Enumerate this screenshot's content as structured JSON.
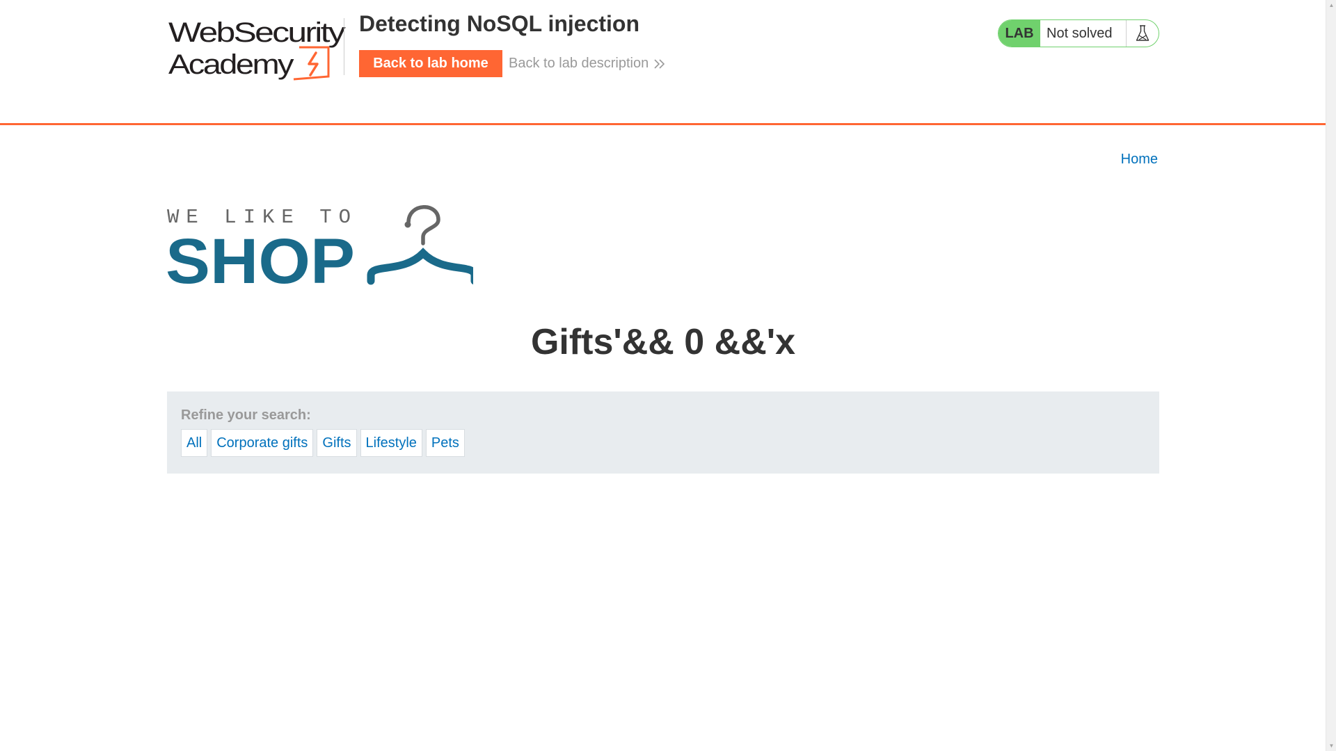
{
  "academy_logo": {
    "line1": "WebSecurity",
    "line2": "Academy"
  },
  "lab": {
    "title": "Detecting NoSQL injection",
    "back_home_label": "Back to lab home",
    "back_description_label": "Back to lab description",
    "status_tag": "LAB",
    "status_text": "Not solved"
  },
  "nav": {
    "home_label": "Home"
  },
  "shop_logo": {
    "tagline": "WE LIKE TO",
    "word": "SHOP"
  },
  "page": {
    "heading": "Gifts'&& 0 &&'x"
  },
  "filters": {
    "label": "Refine your search:",
    "items": [
      "All",
      "Corporate gifts",
      "Gifts",
      "Lifestyle",
      "Pets"
    ]
  },
  "colors": {
    "accent": "#ff6633",
    "link": "#0071bc",
    "status_green": "#70d16d",
    "shop_blue": "#1a6a8a",
    "filter_bg": "#e8ecef"
  },
  "icons": {
    "logo_bolt": "lightning-bolt-icon",
    "description_chevrons": "double-chevron-right-icon",
    "lab_flask": "flask-icon",
    "shop_hanger": "clothes-hanger-icon"
  }
}
